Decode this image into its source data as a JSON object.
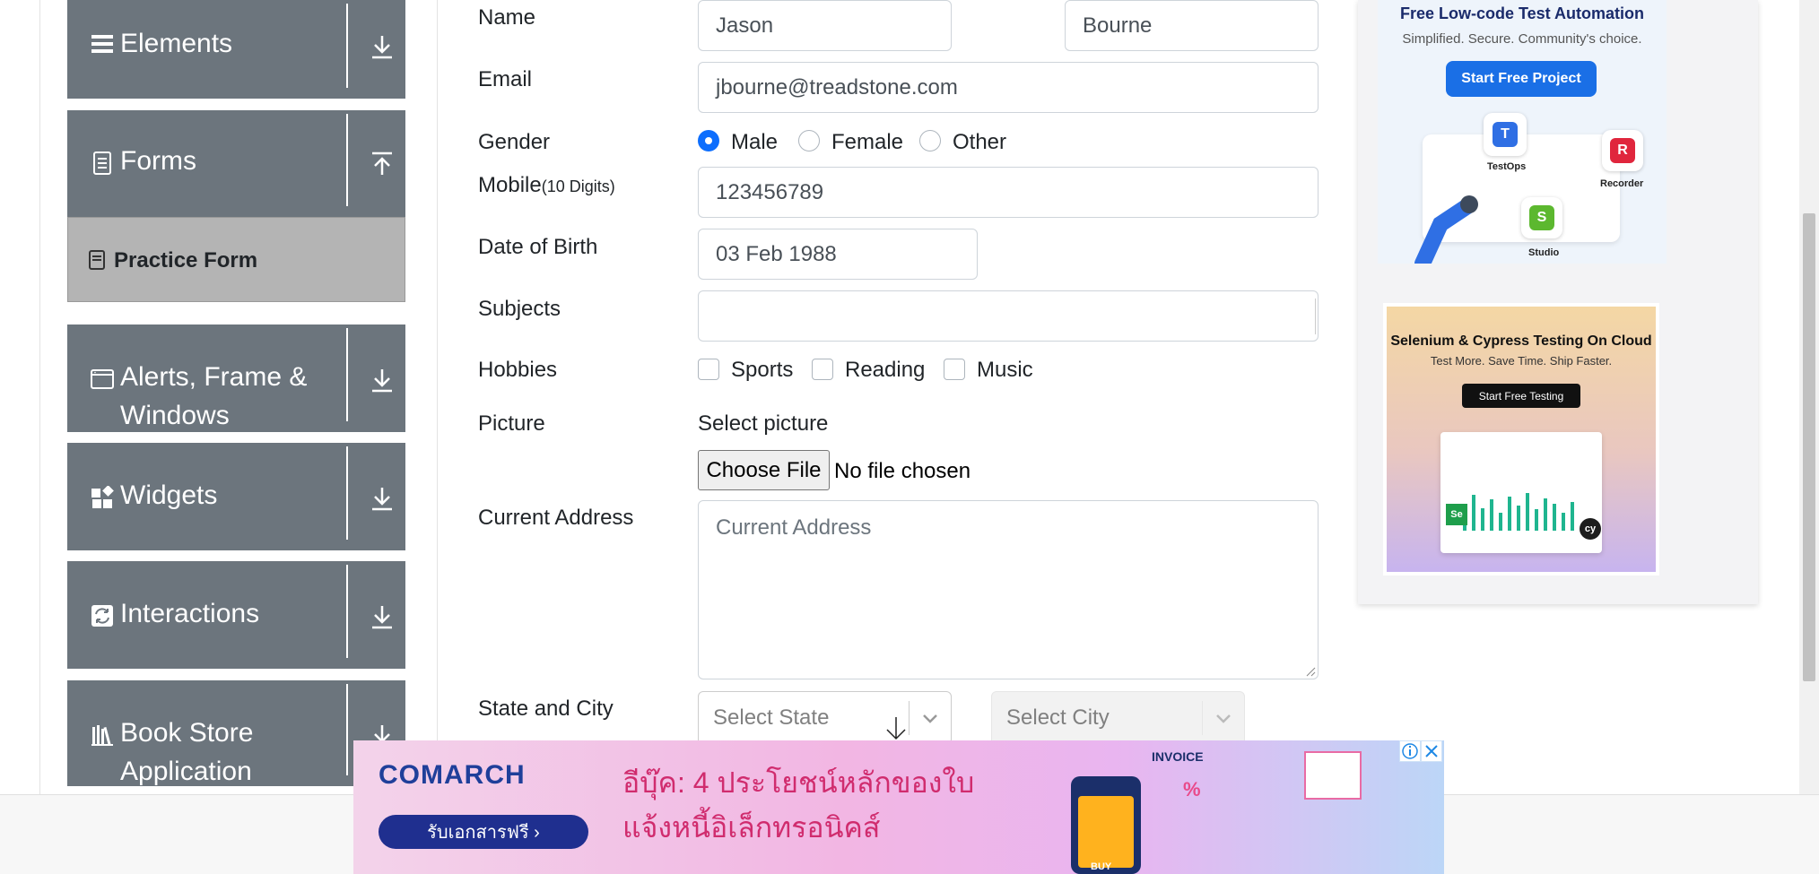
{
  "sidebar": {
    "groups": [
      {
        "label": "Elements",
        "icon": "hamburger-icon",
        "expanded": false
      },
      {
        "label": "Forms",
        "icon": "form-icon",
        "expanded": true
      },
      {
        "label": "Alerts, Frame &",
        "label2": "Windows",
        "icon": "window-icon",
        "expanded": false
      },
      {
        "label": "Widgets",
        "icon": "widgets-icon",
        "expanded": false
      },
      {
        "label": "Interactions",
        "icon": "interactions-icon",
        "expanded": false
      },
      {
        "label": "Book Store",
        "label2": "Application",
        "icon": "books-icon",
        "expanded": false
      }
    ],
    "forms_subitem": {
      "label": "Practice Form",
      "icon": "form-doc-icon",
      "active": true
    }
  },
  "form": {
    "name_label": "Name",
    "first_name": "Jason",
    "last_name": "Bourne",
    "email_label": "Email",
    "email": "jbourne@treadstone.com",
    "gender_label": "Gender",
    "gender_options": [
      "Male",
      "Female",
      "Other"
    ],
    "gender_selected": "Male",
    "mobile_label": "Mobile",
    "mobile_hint": "(10 Digits)",
    "mobile": "123456789",
    "dob_label": "Date of Birth",
    "dob": "03 Feb 1988",
    "subjects_label": "Subjects",
    "subjects_value": "",
    "hobbies_label": "Hobbies",
    "hobbies": [
      "Sports",
      "Reading",
      "Music"
    ],
    "picture_label": "Picture",
    "select_picture": "Select picture",
    "choose_file": "Choose File",
    "no_file": "No file chosen",
    "address_label": "Current Address",
    "address_placeholder": "Current Address",
    "state_city_label": "State and City",
    "state_placeholder": "Select State",
    "city_placeholder": "Select City"
  },
  "ads": {
    "ad1": {
      "title": "Free Low-code Test Automation",
      "subtitle": "Simplified. Secure. Community's choice.",
      "button": "Start Free Project",
      "labels": [
        "TestOps",
        "Recorder",
        "Studio"
      ]
    },
    "ad2": {
      "title": "Selenium & Cypress Testing On Cloud",
      "subtitle": "Test More. Save Time. Ship Faster.",
      "button": "Start Free Testing"
    }
  },
  "banner": {
    "brand": "COMARCH",
    "cta": "รับเอกสารฟรี ›",
    "headline1": "อีบุ๊ค: 4 ประโยชน์หลักของใบ",
    "headline2": "แจ้งหนี้อิเล็กทรอนิคส์",
    "invoice_text": "INVOICE",
    "buy_text": "BUY",
    "percent_text": "%"
  },
  "colors": {
    "sidebar_bg": "#6c757d",
    "active_bg": "#b4b4b4",
    "primary": "#0d6efd"
  }
}
